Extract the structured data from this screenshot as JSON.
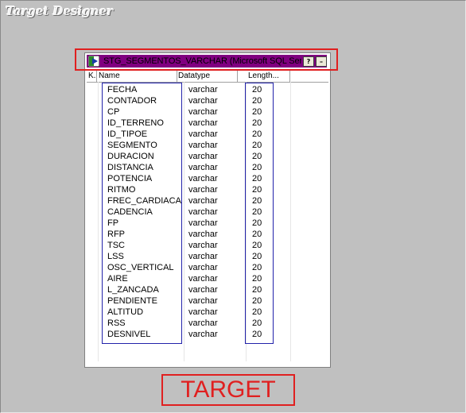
{
  "designer": {
    "title": "Target Designer"
  },
  "source": {
    "title": "STG_SEGMENTOS_VARCHAR (Microsoft SQL Ser...",
    "help_button": "?",
    "minimize_button": "–",
    "columns": {
      "key": "K.",
      "name": "Name",
      "datatype": "Datatype",
      "length": "Length..."
    },
    "rows": [
      {
        "name": "FECHA",
        "type": "varchar",
        "len": "20"
      },
      {
        "name": "CONTADOR",
        "type": "varchar",
        "len": "20"
      },
      {
        "name": "CP",
        "type": "varchar",
        "len": "20"
      },
      {
        "name": "ID_TERRENO",
        "type": "varchar",
        "len": "20"
      },
      {
        "name": "ID_TIPOE",
        "type": "varchar",
        "len": "20"
      },
      {
        "name": "SEGMENTO",
        "type": "varchar",
        "len": "20"
      },
      {
        "name": "DURACION",
        "type": "varchar",
        "len": "20"
      },
      {
        "name": "DISTANCIA",
        "type": "varchar",
        "len": "20"
      },
      {
        "name": "POTENCIA",
        "type": "varchar",
        "len": "20"
      },
      {
        "name": "RITMO",
        "type": "varchar",
        "len": "20"
      },
      {
        "name": "FREC_CARDIACA",
        "type": "varchar",
        "len": "20"
      },
      {
        "name": "CADENCIA",
        "type": "varchar",
        "len": "20"
      },
      {
        "name": "FP",
        "type": "varchar",
        "len": "20"
      },
      {
        "name": "RFP",
        "type": "varchar",
        "len": "20"
      },
      {
        "name": "TSC",
        "type": "varchar",
        "len": "20"
      },
      {
        "name": "LSS",
        "type": "varchar",
        "len": "20"
      },
      {
        "name": "OSC_VERTICAL",
        "type": "varchar",
        "len": "20"
      },
      {
        "name": "AIRE",
        "type": "varchar",
        "len": "20"
      },
      {
        "name": "L_ZANCADA",
        "type": "varchar",
        "len": "20"
      },
      {
        "name": "PENDIENTE",
        "type": "varchar",
        "len": "20"
      },
      {
        "name": "ALTITUD",
        "type": "varchar",
        "len": "20"
      },
      {
        "name": "RSS",
        "type": "varchar",
        "len": "20"
      },
      {
        "name": "DESNIVEL",
        "type": "varchar",
        "len": "20"
      }
    ]
  },
  "annotation": {
    "label": "TARGET"
  },
  "colors": {
    "titlebar": "#800080",
    "highlight_red": "#e02020",
    "highlight_blue": "#2222aa"
  }
}
